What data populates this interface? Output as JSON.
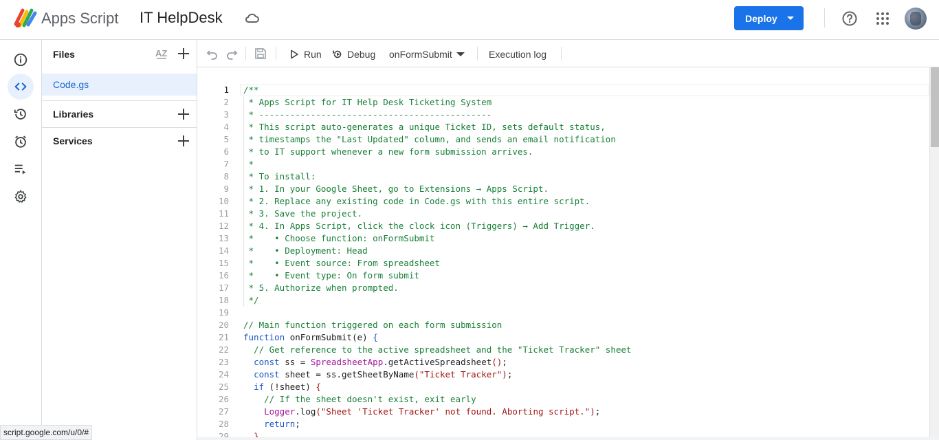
{
  "header": {
    "app_name": "Apps Script",
    "project_name": "IT HelpDesk",
    "deploy_label": "Deploy",
    "icons": [
      "apps-script-logo",
      "cloud-save-icon",
      "help-icon",
      "apps-grid-icon",
      "avatar"
    ]
  },
  "rail": {
    "items": [
      "overview-info-icon",
      "editor-code-icon",
      "history-icon",
      "triggers-clock-icon",
      "executions-list-icon",
      "settings-gear-icon"
    ],
    "active": "editor-code-icon"
  },
  "files_panel": {
    "title": "Files",
    "files": [
      {
        "name": "Code.gs"
      }
    ],
    "sections": [
      {
        "label": "Libraries"
      },
      {
        "label": "Services"
      }
    ]
  },
  "toolbar": {
    "run_label": "Run",
    "debug_label": "Debug",
    "function_name": "onFormSubmit",
    "execution_log_label": "Execution log"
  },
  "status_url": "script.google.com/u/0/#",
  "colors": {
    "accent": "#1a73e8",
    "comment": "#188038",
    "keyword": "#1a56c4",
    "class_name": "#a3169a",
    "string": "#a31515"
  },
  "editor": {
    "current_line": 1,
    "lines": [
      {
        "n": "1",
        "tokens": [
          {
            "t": "cmt",
            "v": "/**"
          }
        ]
      },
      {
        "n": "2",
        "tokens": [
          {
            "t": "cmt",
            "v": " * Apps Script for IT Help Desk Ticketing System"
          }
        ]
      },
      {
        "n": "3",
        "tokens": [
          {
            "t": "cmt",
            "v": " * ---------------------------------------------"
          }
        ]
      },
      {
        "n": "4",
        "tokens": [
          {
            "t": "cmt",
            "v": " * This script auto-generates a unique Ticket ID, sets default status,"
          }
        ]
      },
      {
        "n": "5",
        "tokens": [
          {
            "t": "cmt",
            "v": " * timestamps the \"Last Updated\" column, and sends an email notification"
          }
        ]
      },
      {
        "n": "6",
        "tokens": [
          {
            "t": "cmt",
            "v": " * to IT support whenever a new form submission arrives."
          }
        ]
      },
      {
        "n": "7",
        "tokens": [
          {
            "t": "cmt",
            "v": " *"
          }
        ]
      },
      {
        "n": "8",
        "tokens": [
          {
            "t": "cmt",
            "v": " * To install:"
          }
        ]
      },
      {
        "n": "9",
        "tokens": [
          {
            "t": "cmt",
            "v": " * 1. In your Google Sheet, go to Extensions → Apps Script."
          }
        ]
      },
      {
        "n": "10",
        "tokens": [
          {
            "t": "cmt",
            "v": " * 2. Replace any existing code in Code.gs with this entire script."
          }
        ]
      },
      {
        "n": "11",
        "tokens": [
          {
            "t": "cmt",
            "v": " * 3. Save the project."
          }
        ]
      },
      {
        "n": "12",
        "tokens": [
          {
            "t": "cmt",
            "v": " * 4. In Apps Script, click the clock icon (Triggers) → Add Trigger."
          }
        ]
      },
      {
        "n": "13",
        "tokens": [
          {
            "t": "cmt",
            "v": " *    • Choose function: onFormSubmit"
          }
        ]
      },
      {
        "n": "14",
        "tokens": [
          {
            "t": "cmt",
            "v": " *    • Deployment: Head"
          }
        ]
      },
      {
        "n": "15",
        "tokens": [
          {
            "t": "cmt",
            "v": " *    • Event source: From spreadsheet"
          }
        ]
      },
      {
        "n": "16",
        "tokens": [
          {
            "t": "cmt",
            "v": " *    • Event type: On form submit"
          }
        ]
      },
      {
        "n": "17",
        "tokens": [
          {
            "t": "cmt",
            "v": " * 5. Authorize when prompted."
          }
        ]
      },
      {
        "n": "18",
        "tokens": [
          {
            "t": "cmt",
            "v": " */"
          }
        ]
      },
      {
        "n": "19",
        "tokens": []
      },
      {
        "n": "20",
        "tokens": [
          {
            "t": "cmt",
            "v": "// Main function triggered on each form submission"
          }
        ]
      },
      {
        "n": "21",
        "tokens": [
          {
            "t": "kw",
            "v": "function"
          },
          {
            "t": "fnn",
            "v": " onFormSubmit"
          },
          {
            "t": "",
            "v": "("
          },
          {
            "t": "fnn",
            "v": "e"
          },
          {
            "t": "",
            "v": ") "
          },
          {
            "t": "kw",
            "v": "{"
          }
        ]
      },
      {
        "n": "22",
        "tokens": [
          {
            "t": "cmt",
            "v": "  // Get reference to the active spreadsheet and the \"Ticket Tracker\" sheet"
          }
        ]
      },
      {
        "n": "23",
        "tokens": [
          {
            "t": "",
            "v": "  "
          },
          {
            "t": "kw",
            "v": "const"
          },
          {
            "t": "",
            "v": " ss = "
          },
          {
            "t": "cls",
            "v": "SpreadsheetApp"
          },
          {
            "t": "",
            "v": ".getActiveSpreadsheet"
          },
          {
            "t": "str",
            "v": "()"
          },
          {
            "t": "",
            "v": ";"
          }
        ]
      },
      {
        "n": "24",
        "tokens": [
          {
            "t": "",
            "v": "  "
          },
          {
            "t": "kw",
            "v": "const"
          },
          {
            "t": "",
            "v": " sheet = ss.getSheetByName"
          },
          {
            "t": "str",
            "v": "(\"Ticket Tracker\")"
          },
          {
            "t": "",
            "v": ";"
          }
        ]
      },
      {
        "n": "25",
        "tokens": [
          {
            "t": "",
            "v": "  "
          },
          {
            "t": "kw",
            "v": "if"
          },
          {
            "t": "",
            "v": " ("
          },
          {
            "t": "",
            "v": "!sheet"
          },
          {
            "t": "",
            "v": ") "
          },
          {
            "t": "str",
            "v": "{"
          }
        ]
      },
      {
        "n": "26",
        "tokens": [
          {
            "t": "cmt",
            "v": "    // If the sheet doesn't exist, exit early"
          }
        ]
      },
      {
        "n": "27",
        "tokens": [
          {
            "t": "",
            "v": "    "
          },
          {
            "t": "cls",
            "v": "Logger"
          },
          {
            "t": "",
            "v": ".log"
          },
          {
            "t": "str",
            "v": "(\"Sheet 'Ticket Tracker' not found. Aborting script.\")"
          },
          {
            "t": "",
            "v": ";"
          }
        ]
      },
      {
        "n": "28",
        "tokens": [
          {
            "t": "",
            "v": "    "
          },
          {
            "t": "kw",
            "v": "return"
          },
          {
            "t": "",
            "v": ";"
          }
        ]
      },
      {
        "n": "29",
        "tokens": [
          {
            "t": "",
            "v": "  "
          },
          {
            "t": "str",
            "v": "}"
          }
        ]
      }
    ]
  }
}
